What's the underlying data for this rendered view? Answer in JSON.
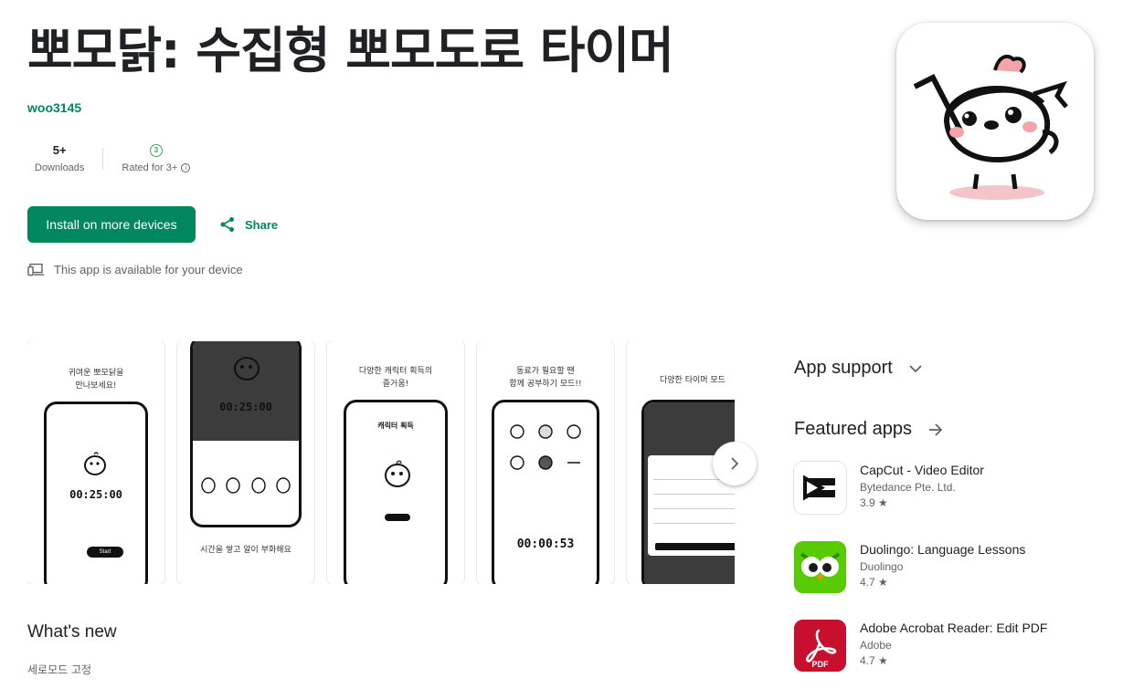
{
  "app": {
    "title": "뽀모닭: 수집형 뽀모도로 타이머",
    "developer": "woo3145",
    "downloads_value": "5+",
    "downloads_label": "Downloads",
    "rating_badge": "3",
    "rating_label": "Rated for 3+",
    "install_label": "Install on more devices",
    "share_label": "Share",
    "availability": "This app is available for your device"
  },
  "screenshots": [
    {
      "caption1": "귀여운 뽀모닭을",
      "caption2": "만나보세요!",
      "timer": "00:25:00",
      "button": "Start"
    },
    {
      "caption1": "시간을 쌓고 알이 부화해요",
      "timer": "00:25:00"
    },
    {
      "caption1": "다양한 캐릭터 획득의",
      "caption2": "즐거움!",
      "inner": "캐릭터 획득"
    },
    {
      "caption1": "동료가 필요할 땐",
      "caption2": "함께 공부하기 모드!!",
      "timer": "00:00:53"
    },
    {
      "caption1": "다양한 타이머 모드"
    }
  ],
  "whats_new": {
    "heading": "What's new",
    "text": "세로모드 고정"
  },
  "sidebar": {
    "app_support": "App support",
    "featured_heading": "Featured apps",
    "featured": [
      {
        "name": "CapCut - Video Editor",
        "developer": "Bytedance Pte. Ltd.",
        "rating": "3.9 ★",
        "icon": "capcut-icon"
      },
      {
        "name": "Duolingo: Language Lessons",
        "developer": "Duolingo",
        "rating": "4.7 ★",
        "icon": "duolingo-icon"
      },
      {
        "name": "Adobe Acrobat Reader: Edit PDF",
        "developer": "Adobe",
        "rating": "4.7 ★",
        "icon": "adobe-acrobat-icon"
      }
    ]
  },
  "colors": {
    "accent": "#01875f",
    "text": "#202124",
    "muted": "#5f6368"
  }
}
